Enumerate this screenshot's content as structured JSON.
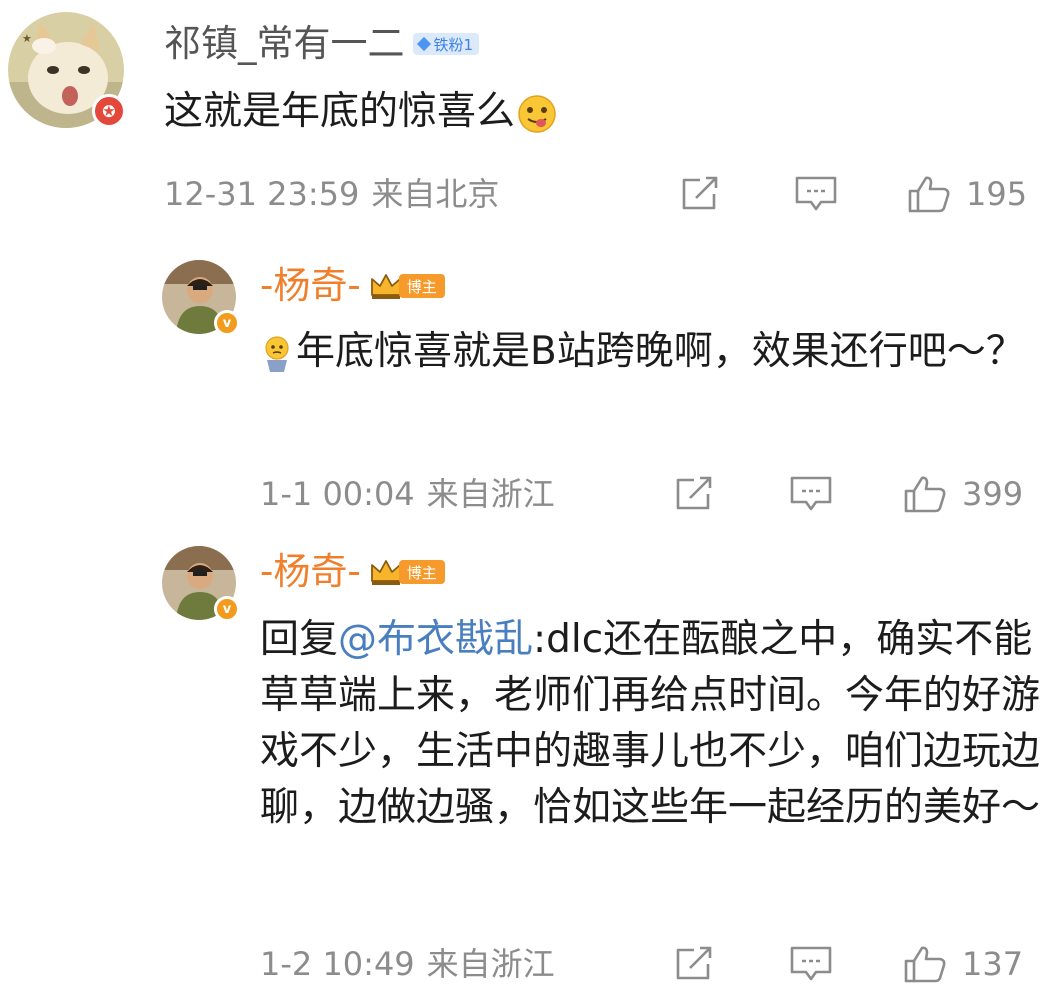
{
  "comments": [
    {
      "username": "祁镇_常有一二",
      "fan_badge": "铁粉1",
      "avatar_badge": "✪",
      "content": "这就是年底的惊喜么",
      "trailing_emoji": "tongue-out-emoji",
      "timestamp": "12-31 23:59",
      "location": "来自北京",
      "likes": "195"
    },
    {
      "username": "-杨奇-",
      "host_badge": "博主",
      "avatar_badge": "v",
      "leading_emoji": "confused-emoji",
      "content": "年底惊喜就是B站跨晚啊，效果还行吧～？",
      "timestamp": "1-1 00:04",
      "location": "来自浙江",
      "likes": "399"
    },
    {
      "username": "-杨奇-",
      "host_badge": "博主",
      "avatar_badge": "v",
      "reply_prefix": "回复",
      "mention": "@布衣戡乱",
      "content": ":dlc还在酝酿之中，确实不能草草端上来，老师们再给点时间。今年的好游戏不少，生活中的趣事儿也不少，咱们边玩边聊，边做边骚，恰如这些年一起经历的美好～",
      "timestamp": "1-2 10:49",
      "location": "来自浙江",
      "likes": "137"
    }
  ],
  "colors": {
    "host_name": "#f07f2c",
    "meta_gray": "#8c8c8c",
    "mention_blue": "#4a7fbf",
    "fan_badge_bg": "#dce9fb",
    "host_badge_bg": "#f59a2b"
  },
  "icons": [
    "repost-icon",
    "comment-icon",
    "like-icon",
    "crown-icon",
    "diamond-icon"
  ]
}
